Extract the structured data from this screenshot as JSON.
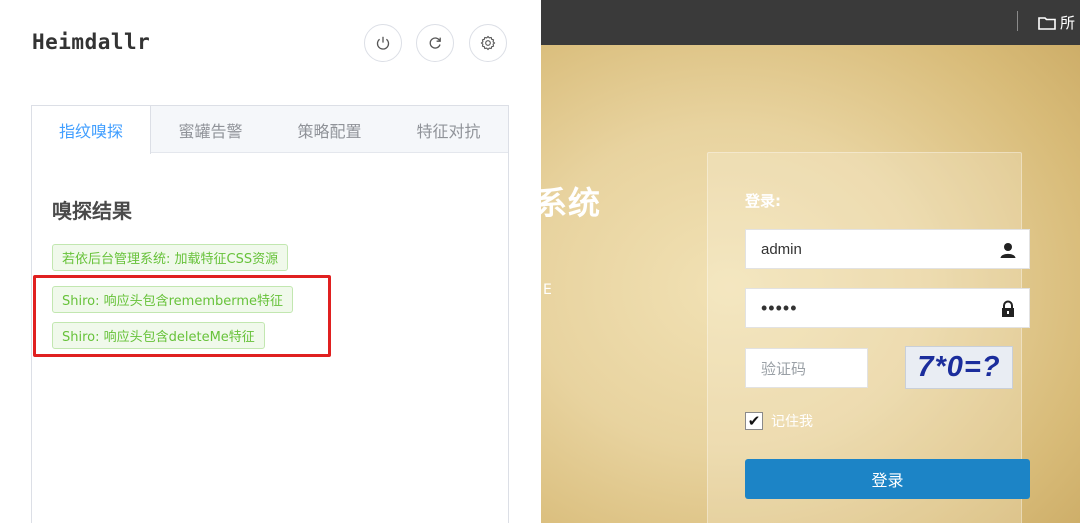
{
  "popup": {
    "app_name": "Heimdallr",
    "buttons": {
      "power": "power-icon",
      "refresh": "refresh-icon",
      "settings": "settings-icon"
    },
    "tabs": [
      {
        "label": "指纹嗅探",
        "active": true
      },
      {
        "label": "蜜罐告警",
        "active": false
      },
      {
        "label": "策略配置",
        "active": false
      },
      {
        "label": "特征对抗",
        "active": false
      }
    ],
    "panel": {
      "heading": "嗅探结果",
      "results": [
        "若依后台管理系统: 加载特征CSS资源",
        "Shiro: 响应头包含rememberme特征",
        "Shiro: 响应头包含deleteMe特征"
      ]
    }
  },
  "site": {
    "topbar_folder_label": "所",
    "title_fragment": "系统",
    "subtitle_fragment": "E",
    "login": {
      "heading": "登录:",
      "username_value": "admin",
      "password_value": "•••••",
      "captcha_placeholder": "验证码",
      "captcha_text": "7*0=?",
      "remember_label": "记住我",
      "remember_checked": true,
      "submit_label": "登录"
    }
  },
  "colors": {
    "tab_active": "#409eff",
    "tag_text": "#67c23a",
    "tag_bg": "#f0f9eb",
    "highlight": "#e02020",
    "login_button": "#1c84c6",
    "site_background": "#e8d39f"
  }
}
